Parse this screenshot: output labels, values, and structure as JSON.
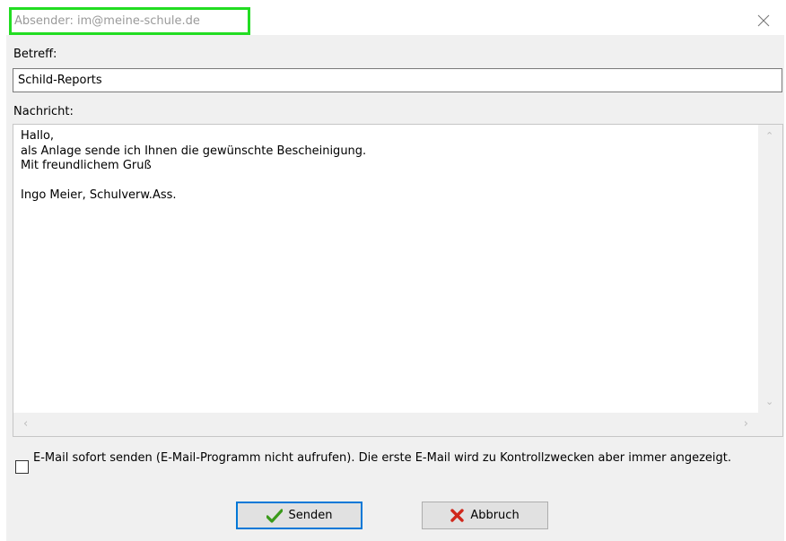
{
  "window": {
    "title": "Absender: im@meine-schule.de"
  },
  "form": {
    "subject_label": "Betreff:",
    "subject_value": "Schild-Reports",
    "message_label": "Nachricht:",
    "message_value": "Hallo,\nals Anlage sende ich Ihnen die gewünschte Bescheinigung.\nMit freundlichem Gruß\n\nIngo Meier, Schulverw.Ass.",
    "send_immediately_label": "E-Mail sofort senden (E-Mail-Programm nicht aufrufen). Die erste E-Mail wird zu Kontrollzwecken aber immer angezeigt.",
    "send_immediately_checked": false
  },
  "buttons": {
    "send_label": "Senden",
    "cancel_label": "Abbruch"
  },
  "icons": {
    "close": "close-icon",
    "send": "checkmark-icon",
    "cancel": "x-icon"
  },
  "colors": {
    "highlight": "#22dd22",
    "default_button_border": "#0078d7",
    "check_green": "#3a9a1a",
    "cancel_red": "#d0281c"
  }
}
